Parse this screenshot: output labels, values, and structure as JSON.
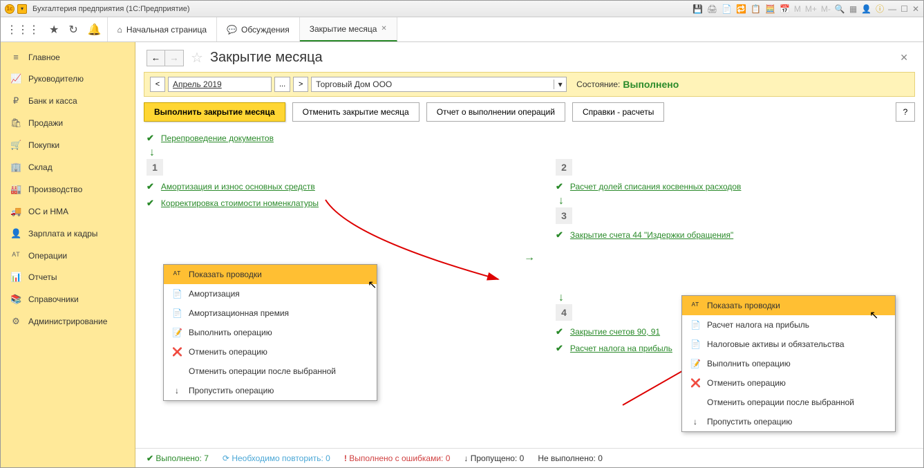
{
  "window_title": "Бухгалтерия предприятия  (1С:Предприятие)",
  "tabs": {
    "home": "Начальная страница",
    "discuss": "Обсуждения",
    "closing": "Закрытие месяца"
  },
  "sidebar": [
    {
      "icon": "≡",
      "label": "Главное"
    },
    {
      "icon": "📈",
      "label": "Руководителю"
    },
    {
      "icon": "₽",
      "label": "Банк и касса"
    },
    {
      "icon": "🛍",
      "label": "Продажи"
    },
    {
      "icon": "🛒",
      "label": "Покупки"
    },
    {
      "icon": "🏢",
      "label": "Склад"
    },
    {
      "icon": "🏭",
      "label": "Производство"
    },
    {
      "icon": "🚚",
      "label": "ОС и НМА"
    },
    {
      "icon": "👤",
      "label": "Зарплата и кадры"
    },
    {
      "icon": "ᴬᵀ",
      "label": "Операции"
    },
    {
      "icon": "📊",
      "label": "Отчеты"
    },
    {
      "icon": "📚",
      "label": "Справочники"
    },
    {
      "icon": "⚙",
      "label": "Администрирование"
    }
  ],
  "page": {
    "title": "Закрытие месяца",
    "period": "Апрель 2019",
    "org": "Торговый Дом ООО",
    "state_label": "Состояние:",
    "state_value": "Выполнено"
  },
  "actions": {
    "run": "Выполнить закрытие месяца",
    "cancel": "Отменить закрытие месяца",
    "report": "Отчет о выполнении операций",
    "refs": "Справки - расчеты",
    "help": "?"
  },
  "ops": {
    "repost": "Перепроведение документов",
    "amort": "Амортизация и износ основных средств",
    "corr": "Корректировка стоимости номенклатуры",
    "indirect": "Расчет долей списания косвенных расходов",
    "acc44": "Закрытие счета 44 \"Издержки обращения\"",
    "acc9091": "Закрытие счетов 90, 91",
    "profit": "Расчет налога на прибыль"
  },
  "menu1": [
    {
      "icon": "ᴬᵀ",
      "label": "Показать проводки",
      "hl": true
    },
    {
      "icon": "📄",
      "label": "Амортизация"
    },
    {
      "icon": "📄",
      "label": "Амортизационная премия"
    },
    {
      "icon": "📝",
      "label": "Выполнить операцию"
    },
    {
      "icon": "❌",
      "label": "Отменить операцию"
    },
    {
      "icon": "",
      "label": "Отменить операции после выбранной"
    },
    {
      "icon": "↓",
      "label": "Пропустить операцию"
    }
  ],
  "menu2": [
    {
      "icon": "ᴬᵀ",
      "label": "Показать проводки",
      "hl": true
    },
    {
      "icon": "📄",
      "label": "Расчет налога на прибыль"
    },
    {
      "icon": "📄",
      "label": "Налоговые активы и обязательства"
    },
    {
      "icon": "📝",
      "label": "Выполнить операцию"
    },
    {
      "icon": "❌",
      "label": "Отменить операцию"
    },
    {
      "icon": "",
      "label": "Отменить операции после выбранной"
    },
    {
      "icon": "↓",
      "label": "Пропустить операцию"
    }
  ],
  "status": {
    "done_l": "Выполнено:",
    "done_v": "7",
    "retry_l": "Необходимо повторить:",
    "retry_v": "0",
    "err_l": "Выполнено с ошибками:",
    "err_v": "0",
    "skip_l": "Пропущено:",
    "skip_v": "0",
    "not_l": "Не выполнено:",
    "not_v": "0"
  }
}
